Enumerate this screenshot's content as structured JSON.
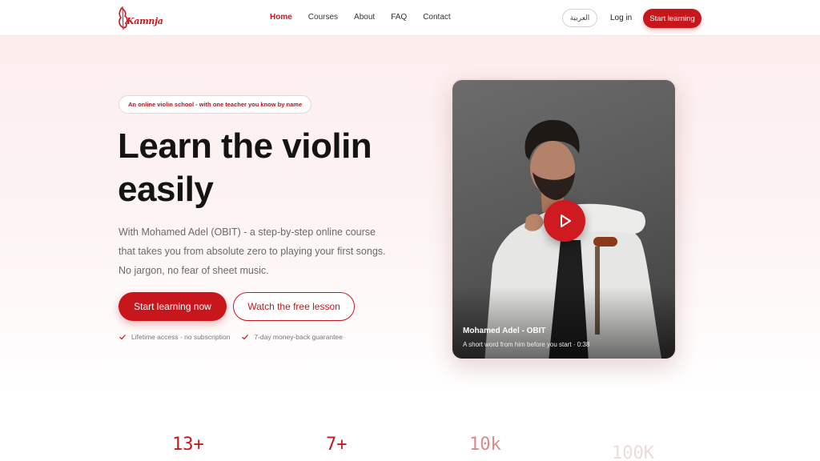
{
  "header": {
    "logo_text": "Kamnja",
    "nav": [
      "Home",
      "Courses",
      "About",
      "FAQ",
      "Contact"
    ],
    "active_nav": "Home",
    "lang_label": "العربية",
    "login_label": "Log in",
    "start_label": "Start learning"
  },
  "hero": {
    "tagline": "An online violin school - with one teacher you know by name",
    "headline_line1": "Learn the violin",
    "headline_line2": "easily",
    "subtext": "With Mohamed Adel (OBIT) - a step-by-step online course that takes you from absolute zero to playing your first songs. No jargon, no fear of sheet music.",
    "cta_primary": "Start learning now",
    "cta_secondary": "Watch the free lesson",
    "checks": [
      "Lifetime access - no subscription",
      "7-day money-back guarantee"
    ]
  },
  "video": {
    "name": "Mohamed Adel - OBIT",
    "caption": "A short word from him before you start · 0:38",
    "play_icon": "play-icon"
  },
  "stats": [
    "13+",
    "7+",
    "10k",
    "100K"
  ],
  "colors": {
    "accent": "#c8161d",
    "background_tint": "#fdeeee"
  }
}
